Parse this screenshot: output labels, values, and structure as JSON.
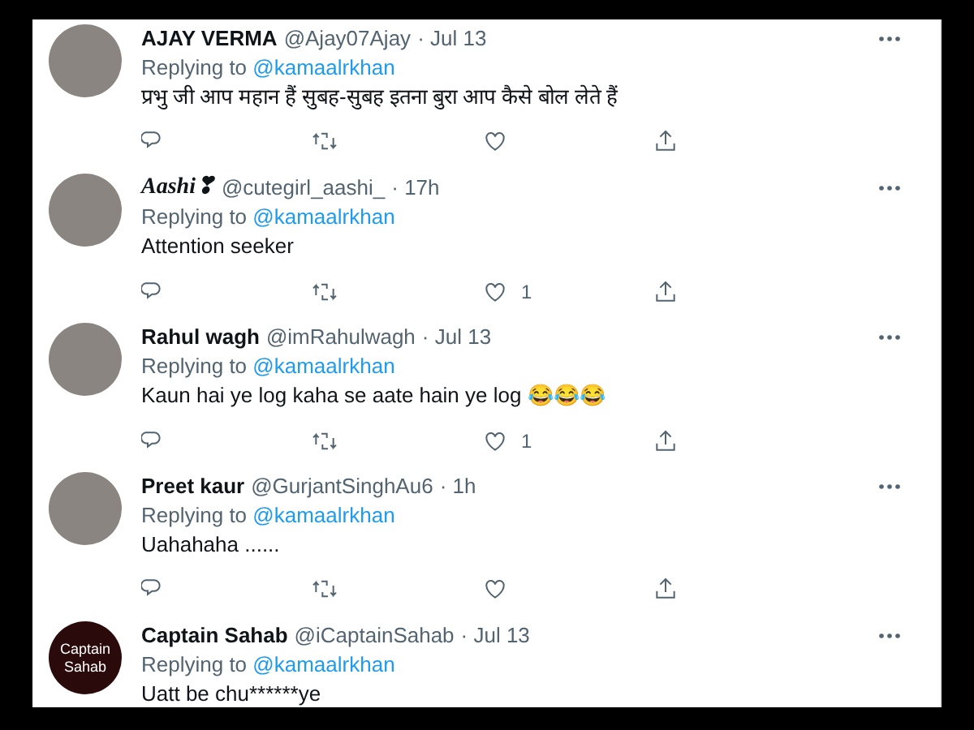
{
  "tweets": [
    {
      "name": "AJAY VERMA",
      "name_italic": false,
      "handle": "@Ajay07Ajay",
      "time": "· Jul 13",
      "replying_label": "Replying to",
      "replying_to": "@kamaalrkhan",
      "text": "प्रभु जी आप महान हैं सुबह-सुबह इतना बुरा आप कैसे बोल लेते हैं"
    },
    {
      "name": "Aashi❣",
      "name_italic": true,
      "handle": "@cutegirl_aashi_",
      "time": "· 17h",
      "replying_label": "Replying to",
      "replying_to": "@kamaalrkhan",
      "text": "Attention seeker",
      "like_count": "1"
    },
    {
      "name": "Rahul wagh",
      "name_italic": false,
      "handle": "@imRahulwagh",
      "time": "· Jul 13",
      "replying_label": "Replying to",
      "replying_to": "@kamaalrkhan",
      "text": "Kaun hai ye log kaha se aate hain ye log 😂😂😂",
      "like_count": "1"
    },
    {
      "name": "Preet kaur",
      "name_italic": false,
      "handle": "@GurjantSinghAu6",
      "time": "· 1h",
      "replying_label": "Replying to",
      "replying_to": "@kamaalrkhan",
      "text": "Uahahaha ......"
    },
    {
      "name": "Captain Sahab",
      "name_italic": false,
      "handle": "@iCaptainSahab",
      "time": "· Jul 13",
      "avatar_text": "Captain Sahab",
      "replying_label": "Replying to",
      "replying_to": "@kamaalrkhan",
      "text": "Uatt be chu******ye"
    }
  ]
}
